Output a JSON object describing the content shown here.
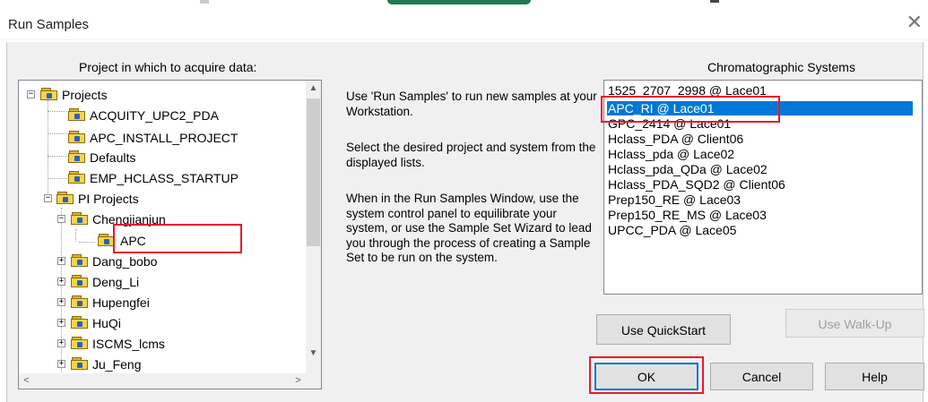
{
  "window": {
    "title": "Run Samples",
    "close_glyph": "✕"
  },
  "left_panel": {
    "heading": "Project in which to acquire data:",
    "tree": [
      {
        "label": "Projects",
        "expander": "−"
      },
      {
        "label": "ACQUITY_UPC2_PDA",
        "expander": ""
      },
      {
        "label": "APC_INSTALL_PROJECT",
        "expander": ""
      },
      {
        "label": "Defaults",
        "expander": ""
      },
      {
        "label": "EMP_HCLASS_STARTUP",
        "expander": ""
      },
      {
        "label": "PI Projects",
        "expander": "−"
      },
      {
        "label": "Chengjianjun",
        "expander": "−"
      },
      {
        "label": "APC",
        "expander": ""
      },
      {
        "label": "Dang_bobo",
        "expander": "+"
      },
      {
        "label": "Deng_Li",
        "expander": "+"
      },
      {
        "label": "Hupengfei",
        "expander": "+"
      },
      {
        "label": "HuQi",
        "expander": "+"
      },
      {
        "label": "ISCMS_lcms",
        "expander": "+"
      },
      {
        "label": "Ju_Feng",
        "expander": "+"
      }
    ],
    "scroll_up": "▲",
    "scroll_down": "▼",
    "scroll_left": "<",
    "scroll_right": ">"
  },
  "middle_panel": {
    "para1": "Use 'Run Samples' to run new samples at your Workstation.",
    "para2": "Select the desired project and system from the displayed lists.",
    "para3": "When in the Run Samples Window, use the system control panel to equilibrate your system, or use the Sample Set Wizard to lead you through the process of creating a Sample Set to be run on the system."
  },
  "right_panel": {
    "heading": "Chromatographic Systems",
    "systems": [
      "1525_2707_2998 @ Lace01",
      "APC_RI @ Lace01",
      "GPC_2414 @ Lace01",
      "Hclass_PDA @ Client06",
      "Hclass_pda @ Lace02",
      "Hclass_pda_QDa @ Lace02",
      "Hclass_PDA_SQD2 @ Client06",
      "Prep150_RE @ Lace03",
      "Prep150_RE_MS @ Lace03",
      "UPCC_PDA @ Lace05"
    ],
    "selected_system": "APC_RI @ Lace01"
  },
  "buttons": {
    "quickstart": "Use QuickStart",
    "walkup": "Use Walk-Up",
    "ok": "OK",
    "cancel": "Cancel",
    "help": "Help"
  },
  "colors": {
    "selection": "#0078d7",
    "highlight_box": "#e8192c",
    "folder": "#f6d44a"
  }
}
